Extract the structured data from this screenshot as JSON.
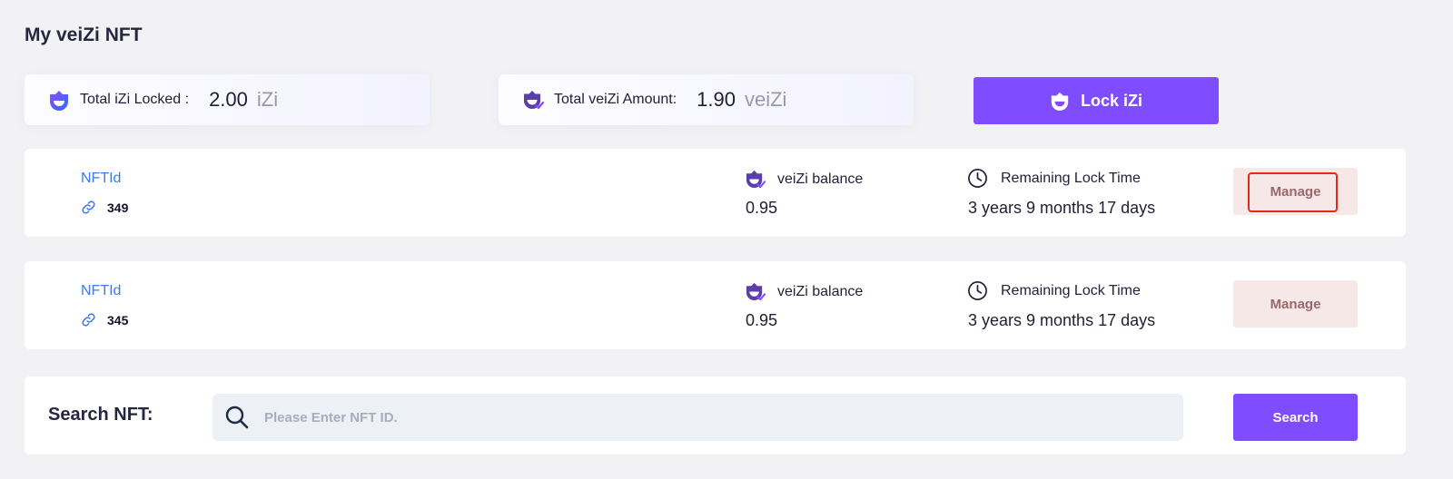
{
  "page": {
    "title": "My veiZi NFT"
  },
  "summary": {
    "locked": {
      "label": "Total iZi Locked :",
      "value": "2.00",
      "unit": "iZi"
    },
    "veizi": {
      "label": "Total veiZi Amount:",
      "value": "1.90",
      "unit": "veiZi"
    },
    "lock_button": "Lock iZi"
  },
  "nfts": [
    {
      "id_label": "NFTId",
      "id": "349",
      "balance_label": "veiZi balance",
      "balance": "0.95",
      "time_label": "Remaining Lock Time",
      "time": "3 years 9 months 17 days",
      "manage": "Manage"
    },
    {
      "id_label": "NFTId",
      "id": "345",
      "balance_label": "veiZi balance",
      "balance": "0.95",
      "time_label": "Remaining Lock Time",
      "time": "3 years 9 months 17 days",
      "manage": "Manage"
    }
  ],
  "search": {
    "label": "Search NFT:",
    "placeholder": "Please Enter NFT ID.",
    "button": "Search"
  },
  "colors": {
    "accent": "#7f4cff",
    "manage_bg": "#f7e8e8",
    "link": "#3c7be8",
    "highlight": "#e6281b"
  },
  "icons": {
    "izi": "izi-logo-icon",
    "veizi": "veizi-logo-icon",
    "link": "link-icon",
    "clock": "clock-icon",
    "search": "search-icon"
  }
}
